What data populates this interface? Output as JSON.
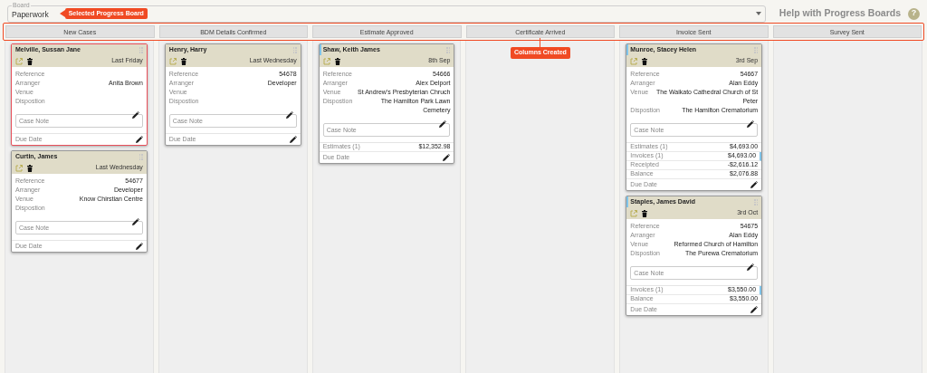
{
  "board": {
    "legend": "Board",
    "value": "Paperwork",
    "callout": "Selected Progress Board"
  },
  "help": {
    "label": "Help with Progress Boards",
    "icon": "?"
  },
  "columns_callout": "Columns Created",
  "columns": [
    {
      "title": "New Cases",
      "cards": [
        {
          "name": "Melville, Sussan Jane",
          "date": "Last Friday",
          "selected": true,
          "accent": false,
          "fields": [
            {
              "label": "Reference"
            },
            {
              "label": "Arranger",
              "value": "Anita Brown"
            },
            {
              "label": "Venue"
            },
            {
              "label": "Dispostion"
            }
          ],
          "note": {
            "placeholder": "Case Note"
          },
          "due": "Due Date"
        },
        {
          "name": "Curtin, James",
          "date": "Last Wednesday",
          "selected": false,
          "accent": false,
          "fields": [
            {
              "label": "Reference",
              "value": "54677"
            },
            {
              "label": "Arranger",
              "value": "Developer"
            },
            {
              "label": "Venue",
              "value": "Know Chirstian Centre"
            },
            {
              "label": "Dispostion"
            }
          ],
          "note": {
            "placeholder": "Case Note"
          },
          "due": "Due Date"
        }
      ]
    },
    {
      "title": "BDM Details Confirmed",
      "cards": [
        {
          "name": "Henry, Harry",
          "date": "Last Wednesday",
          "selected": false,
          "accent": false,
          "fields": [
            {
              "label": "Reference",
              "value": "54678"
            },
            {
              "label": "Arranger",
              "value": "Developer"
            },
            {
              "label": "Venue"
            },
            {
              "label": "Dispostion"
            }
          ],
          "note": {
            "placeholder": "Case Note"
          },
          "due": "Due Date"
        }
      ]
    },
    {
      "title": "Estimate Approved",
      "cards": [
        {
          "name": "Shaw, Keith James",
          "date": "8th Sep",
          "selected": false,
          "accent": true,
          "fields": [
            {
              "label": "Reference",
              "value": "54666"
            },
            {
              "label": "Arranger",
              "value": "Alex Delport"
            },
            {
              "label": "Venue",
              "value": "St Andrew's Presbyterian Chruch"
            },
            {
              "label": "Dispostion",
              "value": "The Hamilton Park Lawn Cemetery"
            }
          ],
          "note": {
            "placeholder": "Case Note"
          },
          "totals": [
            {
              "label": "Estimates (1)",
              "value": "$12,352.98",
              "flagged": false
            }
          ],
          "due": "Due Date"
        }
      ]
    },
    {
      "title": "Certificate Arrived"
    },
    {
      "title": "Invoice Sent",
      "cards": [
        {
          "name": "Munroe, Stacey Helen",
          "date": "3rd Sep",
          "selected": false,
          "accent": true,
          "fields": [
            {
              "label": "Reference",
              "value": "54667"
            },
            {
              "label": "Arranger",
              "value": "Alan Eddy"
            },
            {
              "label": "Venue",
              "value": "The Waikato Cathedral Church of St Peter"
            },
            {
              "label": "Dispostion",
              "value": "The Hamilton Crematorium"
            }
          ],
          "note": {
            "placeholder": "Case Note"
          },
          "totals": [
            {
              "label": "Estimates (1)",
              "value": "$4,693.00",
              "flagged": false
            },
            {
              "label": "Invoices (1)",
              "value": "$4,693.00",
              "flagged": true
            },
            {
              "label": "Receipted",
              "value": "-$2,616.12",
              "flagged": false
            },
            {
              "label": "Balance",
              "value": "$2,076.88",
              "flagged": false
            }
          ],
          "due": "Due Date"
        },
        {
          "name": "Staples, James David",
          "date": "3rd Oct",
          "selected": false,
          "accent": true,
          "fields": [
            {
              "label": "Reference",
              "value": "54675"
            },
            {
              "label": "Arranger",
              "value": "Alan Eddy"
            },
            {
              "label": "Venue",
              "value": "Reformed Church of Hamilton"
            },
            {
              "label": "Dispostion",
              "value": "The Purewa Crematorium"
            }
          ],
          "note": {
            "placeholder": "Case Note"
          },
          "totals": [
            {
              "label": "Invoices (1)",
              "value": "$3,550.00",
              "flagged": true
            },
            {
              "label": "Balance",
              "value": "$3,550.00",
              "flagged": false
            }
          ],
          "due": "Due Date"
        }
      ]
    },
    {
      "title": "Survey Sent"
    }
  ]
}
